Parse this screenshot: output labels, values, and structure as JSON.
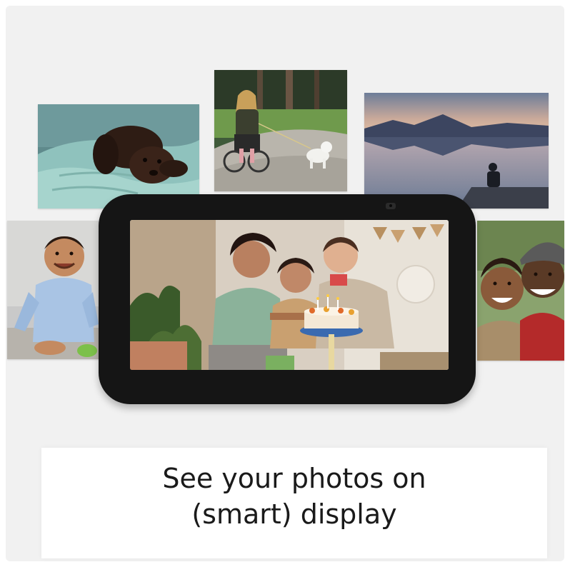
{
  "caption": {
    "line1": "See your photos on",
    "line2": "(smart) display"
  },
  "photos": [
    {
      "name": "puppy-on-blanket-photo",
      "subject": "puppy on blanket"
    },
    {
      "name": "woman-wheelchair-dog-walk-photo",
      "subject": "woman in wheelchair walking dog"
    },
    {
      "name": "lake-pier-sunset-photo",
      "subject": "person on pier by lake"
    },
    {
      "name": "smiling-baby-photo",
      "subject": "smiling baby"
    },
    {
      "name": "smiling-couple-selfie-photo",
      "subject": "couple selfie"
    }
  ],
  "device": {
    "screen_photo": "family birthday celebration with cake"
  }
}
